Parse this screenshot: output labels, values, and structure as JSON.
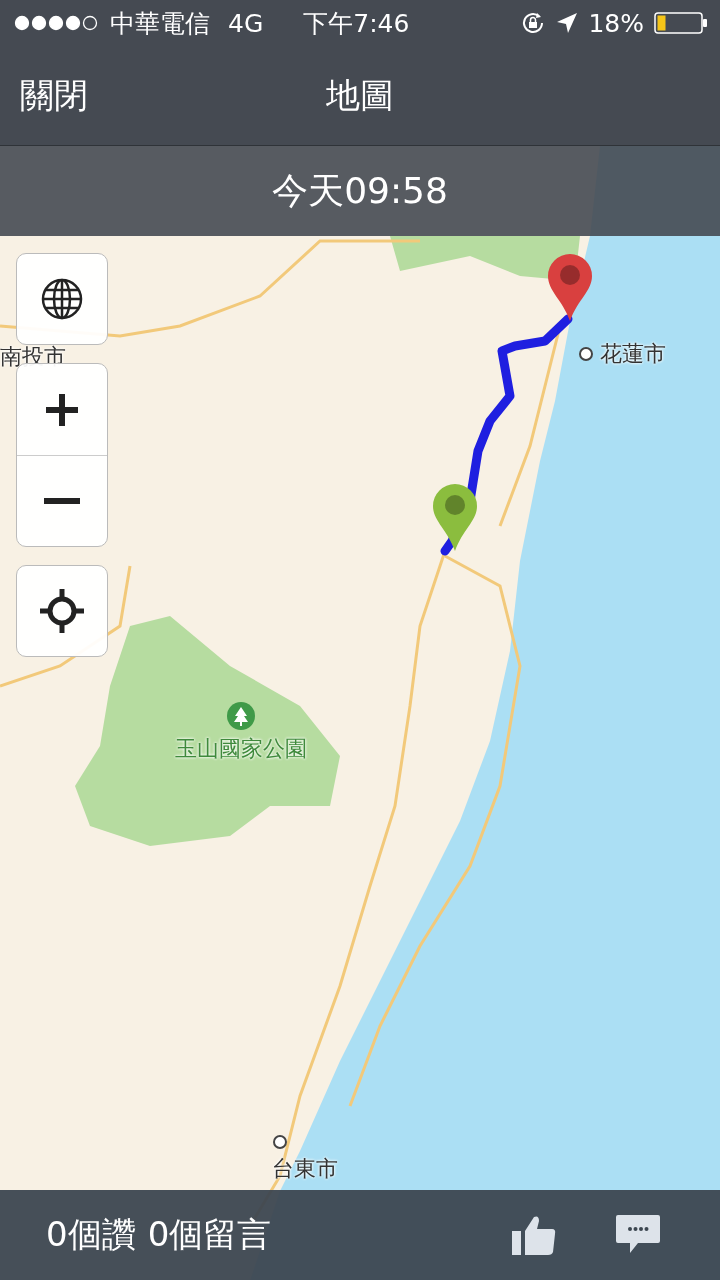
{
  "status_bar": {
    "carrier": "中華電信",
    "network": "4G",
    "time": "下午7:46",
    "battery": "18%"
  },
  "nav": {
    "close": "關閉",
    "title": "地圖"
  },
  "banner": {
    "time": "今天09:58"
  },
  "map": {
    "labels": [
      {
        "text": "南投市",
        "kind": "town"
      },
      {
        "text": "花蓮市",
        "kind": "city"
      },
      {
        "text": "玉山國家公園",
        "kind": "park"
      },
      {
        "text": "台東市",
        "kind": "city"
      }
    ]
  },
  "bottom_bar": {
    "likes": "0個讚",
    "comments": "0個留言"
  }
}
